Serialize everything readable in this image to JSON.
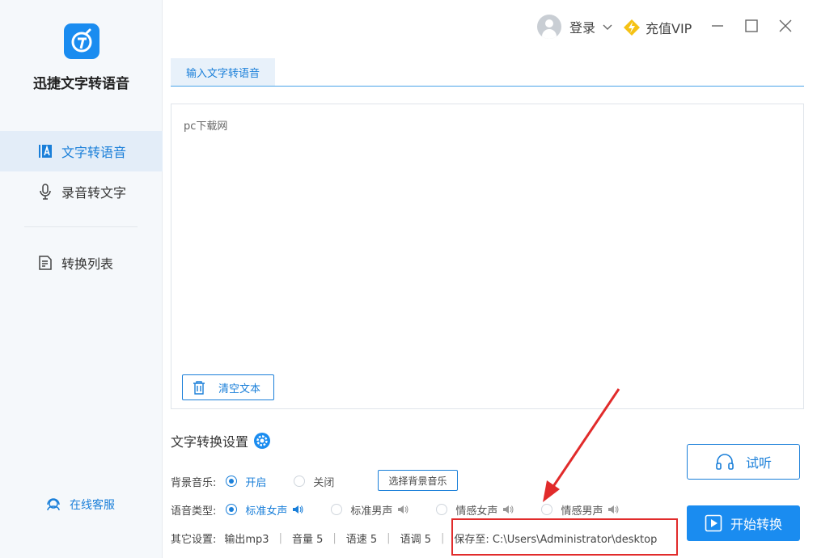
{
  "app": {
    "name": "迅捷文字转语音"
  },
  "sidebar": {
    "items": [
      {
        "label": "文字转语音",
        "icon": "text-a-icon",
        "active": true
      },
      {
        "label": "录音转文字",
        "icon": "microphone-icon",
        "active": false
      },
      {
        "label": "转换列表",
        "icon": "list-document-icon",
        "active": false
      }
    ],
    "service": {
      "label": "在线客服",
      "icon": "headset-person-icon"
    }
  },
  "header": {
    "login_label": "登录",
    "vip_label": "充值VIP"
  },
  "tabs": [
    {
      "label": "输入文字转语音",
      "active": true
    }
  ],
  "editor": {
    "text": "pc下载网"
  },
  "clear_button": {
    "label": "清空文本"
  },
  "settings": {
    "title": "文字转换设置",
    "bgm": {
      "label": "背景音乐:",
      "options": [
        {
          "label": "开启",
          "selected": true
        },
        {
          "label": "关闭",
          "selected": false
        }
      ],
      "choose_label": "选择背景音乐"
    },
    "voice": {
      "label": "语音类型:",
      "options": [
        {
          "label": "标准女声",
          "selected": true
        },
        {
          "label": "标准男声",
          "selected": false
        },
        {
          "label": "情感女声",
          "selected": false
        },
        {
          "label": "情感男声",
          "selected": false
        }
      ]
    },
    "other": {
      "label": "其它设置:",
      "format": "输出mp3",
      "volume": "音量 5",
      "speed": "语速 5",
      "pitch": "语调 5",
      "save_to": "保存至: C:\\Users\\Administrator\\desktop"
    }
  },
  "buttons": {
    "listen": "试听",
    "start": "开始转换"
  },
  "colors": {
    "accent": "#1a8cf0",
    "highlight": "#e12b2b"
  }
}
